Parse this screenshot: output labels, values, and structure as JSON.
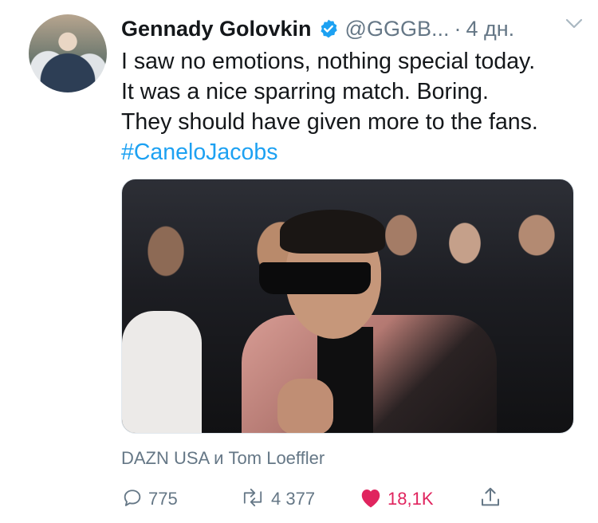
{
  "tweet": {
    "display_name": "Gennady Golovkin",
    "handle": "@GGGB...",
    "separator": "·",
    "timestamp": "4 дн.",
    "text_lines": [
      "I saw no emotions, nothing special today.",
      "It was a nice sparring match.  Boring.",
      "They should have given more to the fans."
    ],
    "hashtag": "#CaneloJacobs",
    "attribution": "DAZN USA и Tom Loeffler"
  },
  "actions": {
    "replies": "775",
    "retweets": "4 377",
    "likes": "18,1K"
  },
  "icons": {
    "verified": "verified-badge-icon",
    "caret": "chevron-down-icon",
    "reply": "reply-icon",
    "retweet": "retweet-icon",
    "like": "heart-icon",
    "share": "share-icon"
  },
  "colors": {
    "text": "#14171a",
    "secondary": "#657786",
    "link": "#1da1f2",
    "like": "#e0245e"
  }
}
